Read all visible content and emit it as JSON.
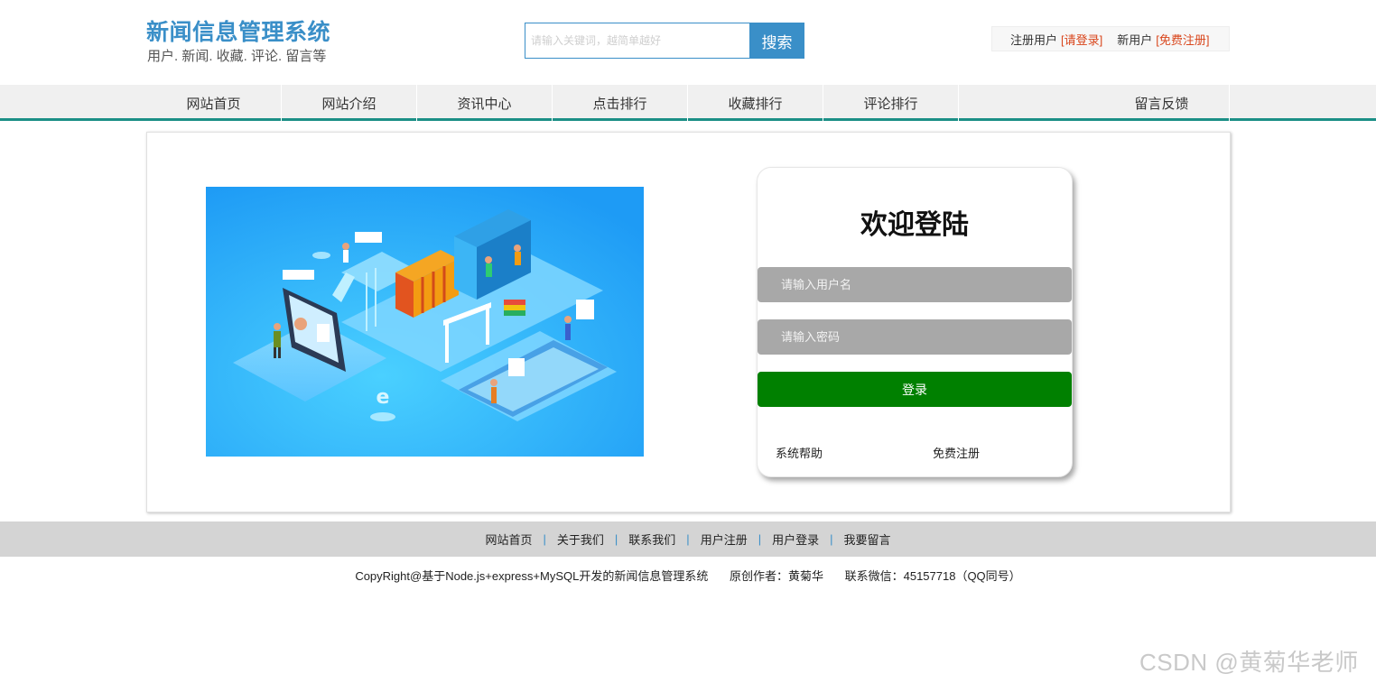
{
  "header": {
    "title": "新闻信息管理系统",
    "subtitle": "用户. 新闻. 收藏. 评论. 留言等",
    "search_placeholder": "请输入关键词，越简单越好",
    "search_button": "搜索",
    "registered_label": "注册用户",
    "login_link": "[请登录]",
    "new_user_label": "新用户",
    "register_link": "[免费注册]"
  },
  "nav": {
    "items": [
      {
        "label": "网站首页"
      },
      {
        "label": "网站介绍"
      },
      {
        "label": "资讯中心"
      },
      {
        "label": "点击排行"
      },
      {
        "label": "收藏排行"
      },
      {
        "label": "评论排行"
      },
      {
        "label": "留言反馈"
      }
    ],
    "accent_color": "#1b8f86"
  },
  "login": {
    "title": "欢迎登陆",
    "username_placeholder": "请输入用户名",
    "password_placeholder": "请输入密码",
    "submit_label": "登录",
    "help_link": "系统帮助",
    "register_link": "免费注册",
    "submit_color": "#008000"
  },
  "footer": {
    "links": [
      "网站首页",
      "关于我们",
      "联系我们",
      "用户注册",
      "用户登录",
      "我要留言"
    ],
    "copyright": "CopyRight@基于Node.js+express+MySQL开发的新闻信息管理系统",
    "author": "原创作者：黄菊华",
    "contact": "联系微信：45157718（QQ同号）"
  },
  "watermark": "CSDN @黄菊华老师"
}
